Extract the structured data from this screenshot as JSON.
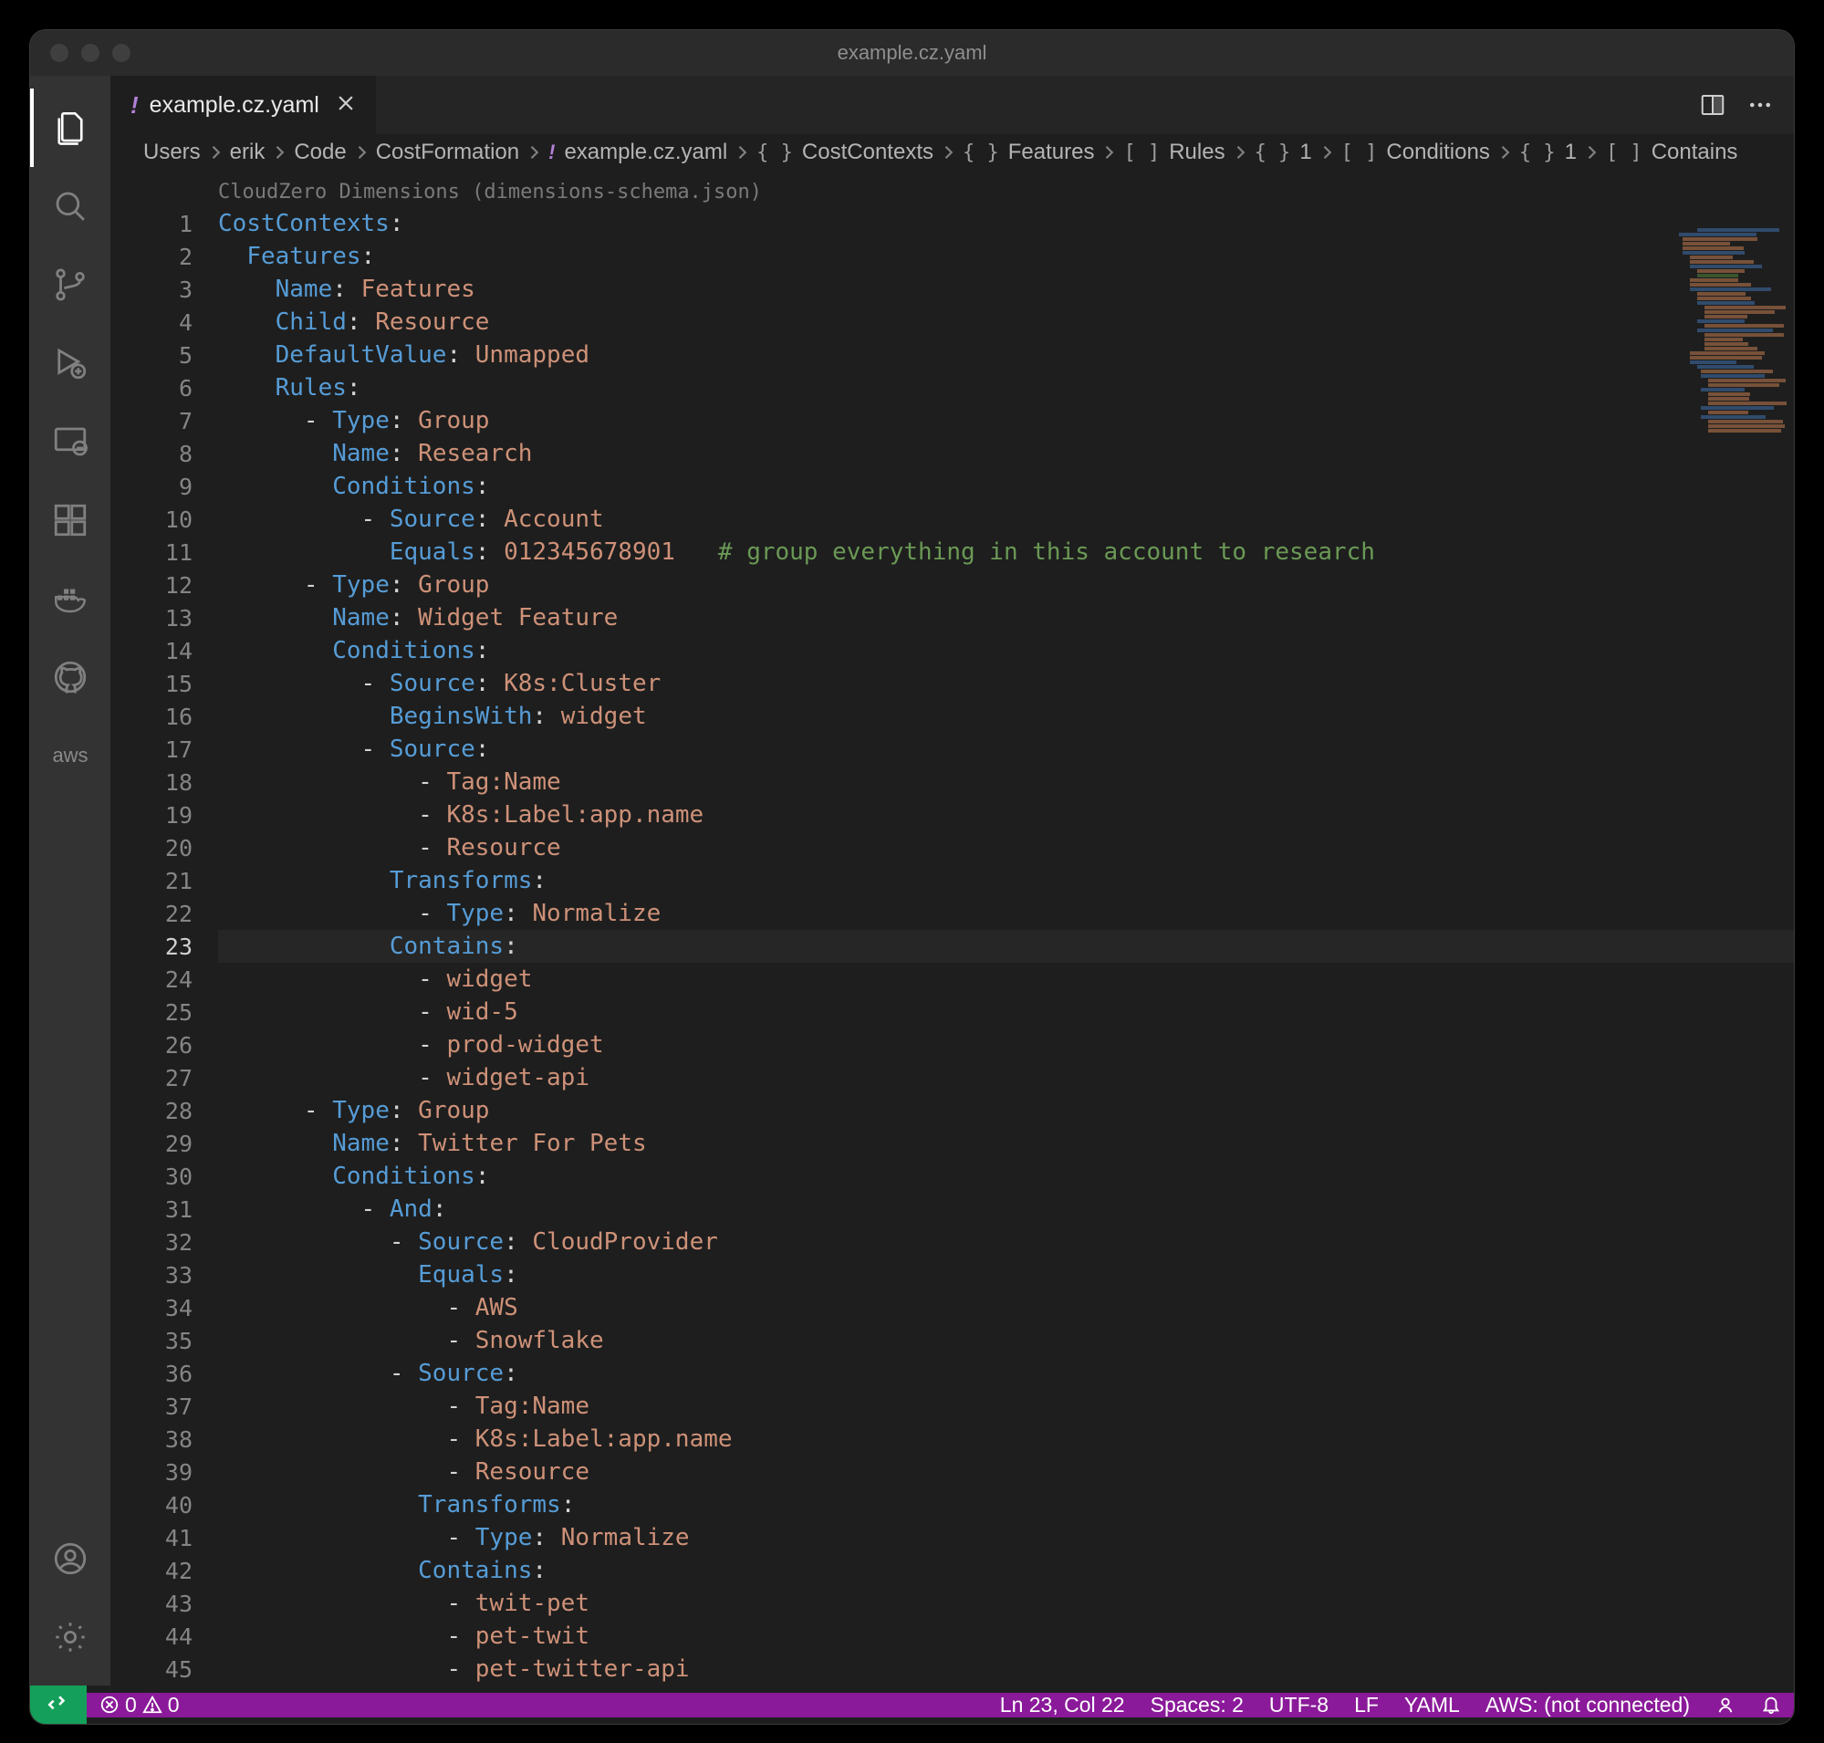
{
  "title": "example.cz.yaml",
  "tab": {
    "label": "example.cz.yaml"
  },
  "breadcrumbs": [
    {
      "kind": "folder",
      "label": "Users"
    },
    {
      "kind": "folder",
      "label": "erik"
    },
    {
      "kind": "folder",
      "label": "Code"
    },
    {
      "kind": "folder",
      "label": "CostFormation"
    },
    {
      "kind": "yaml",
      "label": "example.cz.yaml"
    },
    {
      "kind": "brace",
      "label": "CostContexts"
    },
    {
      "kind": "brace",
      "label": "Features"
    },
    {
      "kind": "bracket",
      "label": "Rules"
    },
    {
      "kind": "brace",
      "label": "1"
    },
    {
      "kind": "bracket",
      "label": "Conditions"
    },
    {
      "kind": "brace",
      "label": "1"
    },
    {
      "kind": "bracket",
      "label": "Contains"
    }
  ],
  "codelens": "CloudZero Dimensions (dimensions-schema.json)",
  "editor": {
    "current_line": 23,
    "line_count": 45,
    "tokens": [
      [
        [
          "k",
          "CostContexts"
        ],
        [
          "p",
          ":"
        ]
      ],
      [
        [
          "p",
          "  "
        ],
        [
          "k",
          "Features"
        ],
        [
          "p",
          ":"
        ]
      ],
      [
        [
          "p",
          "    "
        ],
        [
          "k",
          "Name"
        ],
        [
          "p",
          ": "
        ],
        [
          "s",
          "Features"
        ]
      ],
      [
        [
          "p",
          "    "
        ],
        [
          "k",
          "Child"
        ],
        [
          "p",
          ": "
        ],
        [
          "s",
          "Resource"
        ]
      ],
      [
        [
          "p",
          "    "
        ],
        [
          "k",
          "DefaultValue"
        ],
        [
          "p",
          ": "
        ],
        [
          "s",
          "Unmapped"
        ]
      ],
      [
        [
          "p",
          "    "
        ],
        [
          "k",
          "Rules"
        ],
        [
          "p",
          ":"
        ]
      ],
      [
        [
          "p",
          "      - "
        ],
        [
          "k",
          "Type"
        ],
        [
          "p",
          ": "
        ],
        [
          "s",
          "Group"
        ]
      ],
      [
        [
          "p",
          "        "
        ],
        [
          "k",
          "Name"
        ],
        [
          "p",
          ": "
        ],
        [
          "s",
          "Research"
        ]
      ],
      [
        [
          "p",
          "        "
        ],
        [
          "k",
          "Conditions"
        ],
        [
          "p",
          ":"
        ]
      ],
      [
        [
          "p",
          "          - "
        ],
        [
          "k",
          "Source"
        ],
        [
          "p",
          ": "
        ],
        [
          "s",
          "Account"
        ]
      ],
      [
        [
          "p",
          "            "
        ],
        [
          "k",
          "Equals"
        ],
        [
          "p",
          ": "
        ],
        [
          "s",
          "012345678901"
        ],
        [
          "p",
          "   "
        ],
        [
          "c",
          "# group everything in this account to research"
        ]
      ],
      [
        [
          "p",
          "      - "
        ],
        [
          "k",
          "Type"
        ],
        [
          "p",
          ": "
        ],
        [
          "s",
          "Group"
        ]
      ],
      [
        [
          "p",
          "        "
        ],
        [
          "k",
          "Name"
        ],
        [
          "p",
          ": "
        ],
        [
          "s",
          "Widget Feature"
        ]
      ],
      [
        [
          "p",
          "        "
        ],
        [
          "k",
          "Conditions"
        ],
        [
          "p",
          ":"
        ]
      ],
      [
        [
          "p",
          "          - "
        ],
        [
          "k",
          "Source"
        ],
        [
          "p",
          ": "
        ],
        [
          "s",
          "K8s:Cluster"
        ]
      ],
      [
        [
          "p",
          "            "
        ],
        [
          "k",
          "BeginsWith"
        ],
        [
          "p",
          ": "
        ],
        [
          "s",
          "widget"
        ]
      ],
      [
        [
          "p",
          "          - "
        ],
        [
          "k",
          "Source"
        ],
        [
          "p",
          ":"
        ]
      ],
      [
        [
          "p",
          "              - "
        ],
        [
          "s",
          "Tag:Name"
        ]
      ],
      [
        [
          "p",
          "              - "
        ],
        [
          "s",
          "K8s:Label:app.name"
        ]
      ],
      [
        [
          "p",
          "              - "
        ],
        [
          "s",
          "Resource"
        ]
      ],
      [
        [
          "p",
          "            "
        ],
        [
          "k",
          "Transforms"
        ],
        [
          "p",
          ":"
        ]
      ],
      [
        [
          "p",
          "              - "
        ],
        [
          "k",
          "Type"
        ],
        [
          "p",
          ": "
        ],
        [
          "s",
          "Normalize"
        ]
      ],
      [
        [
          "p",
          "            "
        ],
        [
          "k",
          "Contains"
        ],
        [
          "p",
          ":"
        ]
      ],
      [
        [
          "p",
          "              - "
        ],
        [
          "s",
          "widget"
        ]
      ],
      [
        [
          "p",
          "              - "
        ],
        [
          "s",
          "wid-5"
        ]
      ],
      [
        [
          "p",
          "              - "
        ],
        [
          "s",
          "prod-widget"
        ]
      ],
      [
        [
          "p",
          "              - "
        ],
        [
          "s",
          "widget-api"
        ]
      ],
      [
        [
          "p",
          "      - "
        ],
        [
          "k",
          "Type"
        ],
        [
          "p",
          ": "
        ],
        [
          "s",
          "Group"
        ]
      ],
      [
        [
          "p",
          "        "
        ],
        [
          "k",
          "Name"
        ],
        [
          "p",
          ": "
        ],
        [
          "s",
          "Twitter For Pets"
        ]
      ],
      [
        [
          "p",
          "        "
        ],
        [
          "k",
          "Conditions"
        ],
        [
          "p",
          ":"
        ]
      ],
      [
        [
          "p",
          "          - "
        ],
        [
          "k",
          "And"
        ],
        [
          "p",
          ":"
        ]
      ],
      [
        [
          "p",
          "            - "
        ],
        [
          "k",
          "Source"
        ],
        [
          "p",
          ": "
        ],
        [
          "s",
          "CloudProvider"
        ]
      ],
      [
        [
          "p",
          "              "
        ],
        [
          "k",
          "Equals"
        ],
        [
          "p",
          ":"
        ]
      ],
      [
        [
          "p",
          "                - "
        ],
        [
          "s",
          "AWS"
        ]
      ],
      [
        [
          "p",
          "                - "
        ],
        [
          "s",
          "Snowflake"
        ]
      ],
      [
        [
          "p",
          "            - "
        ],
        [
          "k",
          "Source"
        ],
        [
          "p",
          ":"
        ]
      ],
      [
        [
          "p",
          "                - "
        ],
        [
          "s",
          "Tag:Name"
        ]
      ],
      [
        [
          "p",
          "                - "
        ],
        [
          "s",
          "K8s:Label:app.name"
        ]
      ],
      [
        [
          "p",
          "                - "
        ],
        [
          "s",
          "Resource"
        ]
      ],
      [
        [
          "p",
          "              "
        ],
        [
          "k",
          "Transforms"
        ],
        [
          "p",
          ":"
        ]
      ],
      [
        [
          "p",
          "                - "
        ],
        [
          "k",
          "Type"
        ],
        [
          "p",
          ": "
        ],
        [
          "s",
          "Normalize"
        ]
      ],
      [
        [
          "p",
          "              "
        ],
        [
          "k",
          "Contains"
        ],
        [
          "p",
          ":"
        ]
      ],
      [
        [
          "p",
          "                - "
        ],
        [
          "s",
          "twit-pet"
        ]
      ],
      [
        [
          "p",
          "                - "
        ],
        [
          "s",
          "pet-twit"
        ]
      ],
      [
        [
          "p",
          "                - "
        ],
        [
          "s",
          "pet-twitter-api"
        ]
      ]
    ]
  },
  "statusbar": {
    "errors": "0",
    "warnings": "0",
    "cursor": "Ln 23, Col 22",
    "indent": "Spaces: 2",
    "encoding": "UTF-8",
    "eol": "LF",
    "language": "YAML",
    "aws": "AWS: (not connected)"
  },
  "activity": {
    "aws_label": "aws"
  }
}
